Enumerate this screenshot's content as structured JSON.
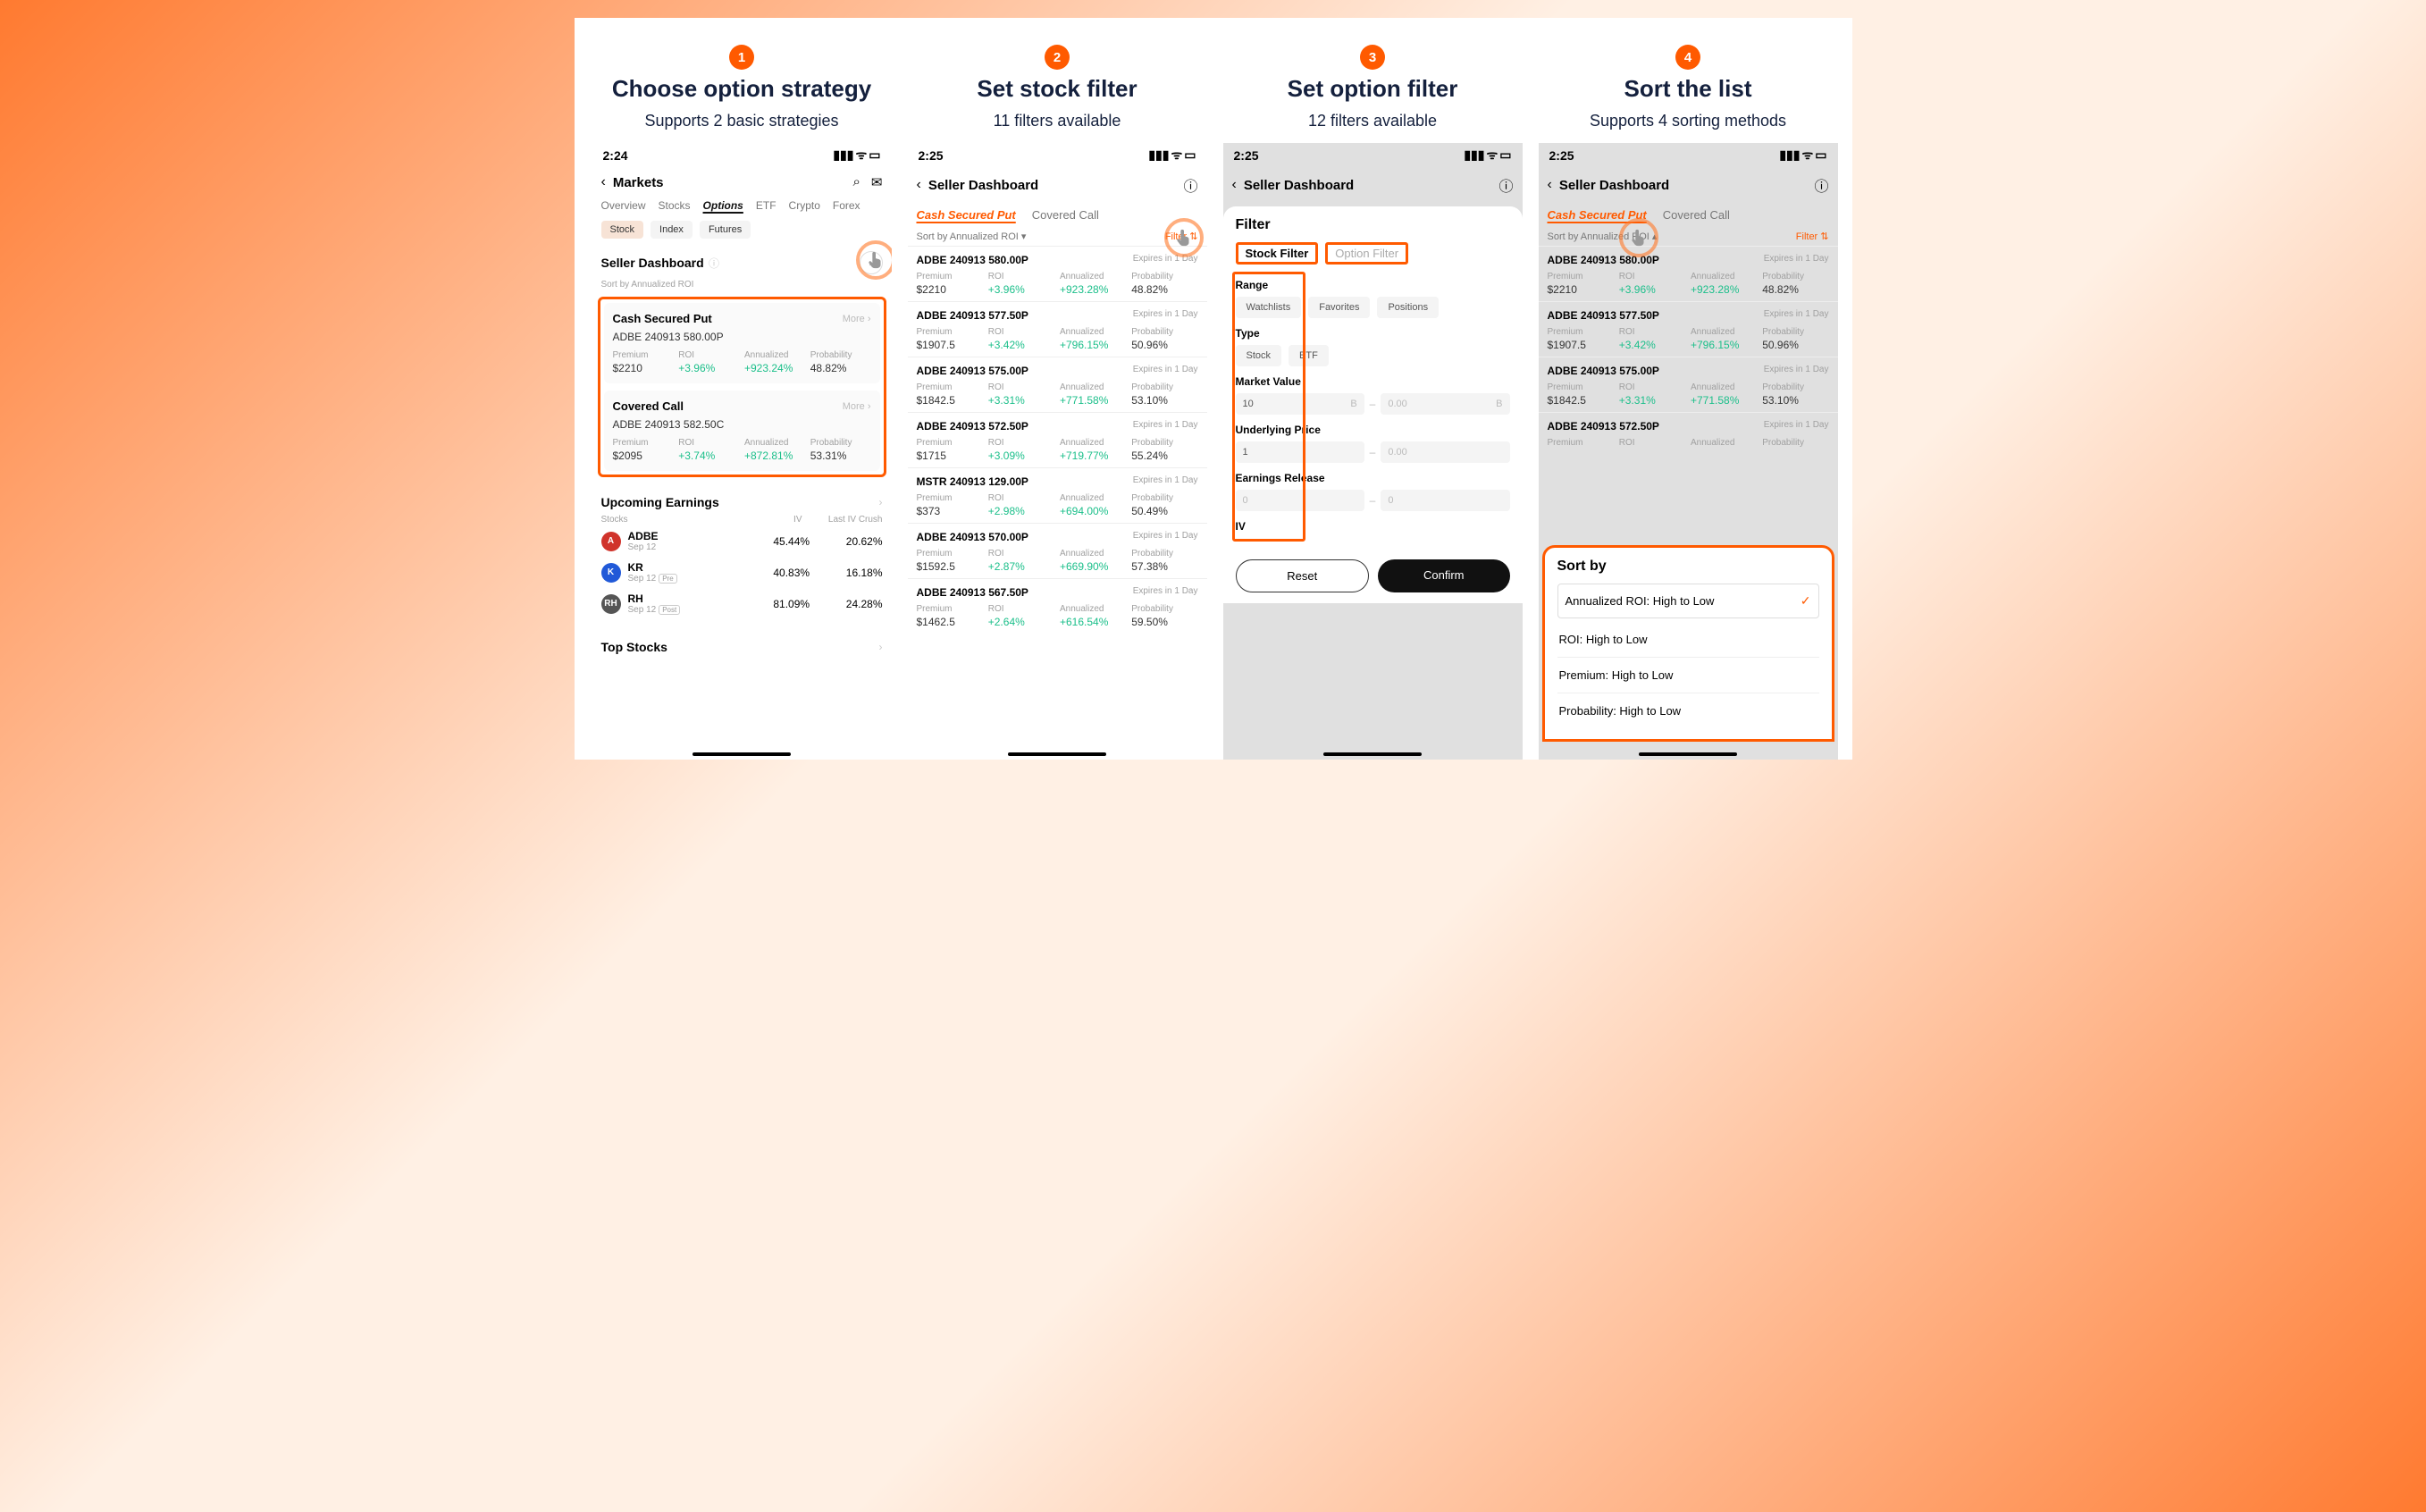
{
  "steps": [
    {
      "num": "1",
      "title": "Choose option strategy",
      "subtitle": "Supports 2 basic strategies"
    },
    {
      "num": "2",
      "title": "Set stock filter",
      "subtitle": "11 filters available"
    },
    {
      "num": "3",
      "title": "Set option filter",
      "subtitle": "12 filters available"
    },
    {
      "num": "4",
      "title": "Sort  the list",
      "subtitle": "Supports 4 sorting methods"
    }
  ],
  "screen1": {
    "time": "2:24",
    "header": "Markets",
    "tabs": [
      "Overview",
      "Stocks",
      "Options",
      "ETF",
      "Crypto",
      "Forex"
    ],
    "tabs_active": "Options",
    "chips": [
      "Stock",
      "Index",
      "Futures"
    ],
    "section": "Seller Dashboard",
    "sort": "Sort by Annualized ROI",
    "cards": [
      {
        "name": "Cash Secured Put",
        "more": "More  ›",
        "symbol": "ADBE 240913 580.00P",
        "premium": "$2210",
        "roi": "+3.96%",
        "ann": "+923.24%",
        "prob": "48.82%"
      },
      {
        "name": "Covered Call",
        "more": "More  ›",
        "symbol": "ADBE 240913 582.50C",
        "premium": "$2095",
        "roi": "+3.74%",
        "ann": "+872.81%",
        "prob": "53.31%"
      }
    ],
    "metric_labels": {
      "premium": "Premium",
      "roi": "ROI",
      "ann": "Annualized",
      "prob": "Probability"
    },
    "earnings": {
      "title": "Upcoming Earnings",
      "cols": {
        "stocks": "Stocks",
        "iv": "IV",
        "crush": "Last IV Crush"
      },
      "rows": [
        {
          "icon": "A",
          "bg": "#d0332b",
          "ticker": "ADBE",
          "date": "Sep 12",
          "tag": "",
          "iv": "45.44%",
          "crush": "20.62%"
        },
        {
          "icon": "K",
          "bg": "#2159d8",
          "ticker": "KR",
          "date": "Sep 12",
          "tag": "Pre",
          "iv": "40.83%",
          "crush": "16.18%"
        },
        {
          "icon": "RH",
          "bg": "#555",
          "ticker": "RH",
          "date": "Sep 12",
          "tag": "Post",
          "iv": "81.09%",
          "crush": "24.28%"
        }
      ]
    },
    "top": "Top Stocks"
  },
  "screen2": {
    "time": "2:25",
    "header": "Seller Dashboard",
    "strategy": {
      "a": "Cash Secured Put",
      "b": "Covered Call"
    },
    "sort": "Sort by Annualized ROI ▾",
    "filter": "Filter ⇅",
    "expires": "Expires in 1 Day",
    "labels": {
      "premium": "Premium",
      "roi": "ROI",
      "ann": "Annualized",
      "prob": "Probability"
    },
    "rows": [
      {
        "sym": "ADBE 240913 580.00P",
        "premium": "$2210",
        "roi": "+3.96%",
        "ann": "+923.28%",
        "prob": "48.82%"
      },
      {
        "sym": "ADBE 240913 577.50P",
        "premium": "$1907.5",
        "roi": "+3.42%",
        "ann": "+796.15%",
        "prob": "50.96%"
      },
      {
        "sym": "ADBE 240913 575.00P",
        "premium": "$1842.5",
        "roi": "+3.31%",
        "ann": "+771.58%",
        "prob": "53.10%"
      },
      {
        "sym": "ADBE 240913 572.50P",
        "premium": "$1715",
        "roi": "+3.09%",
        "ann": "+719.77%",
        "prob": "55.24%"
      },
      {
        "sym": "MSTR 240913 129.00P",
        "premium": "$373",
        "roi": "+2.98%",
        "ann": "+694.00%",
        "prob": "50.49%"
      },
      {
        "sym": "ADBE 240913 570.00P",
        "premium": "$1592.5",
        "roi": "+2.87%",
        "ann": "+669.90%",
        "prob": "57.38%"
      },
      {
        "sym": "ADBE 240913 567.50P",
        "premium": "$1462.5",
        "roi": "+2.64%",
        "ann": "+616.54%",
        "prob": "59.50%"
      }
    ]
  },
  "screen3": {
    "time": "2:25",
    "header": "Seller Dashboard",
    "panel_title": "Filter",
    "tabs": {
      "a": "Stock Filter",
      "b": "Option Filter"
    },
    "sections": {
      "range": "Range",
      "range_items": [
        "Watchlists",
        "Favorites",
        "Positions"
      ],
      "type": "Type",
      "type_items": [
        "Stock",
        "ETF"
      ],
      "mv": "Market Value",
      "mv_lo": "10",
      "mv_hi": "0.00",
      "mv_suffix": "B",
      "up": "Underlying Price",
      "up_lo": "1",
      "up_hi": "0.00",
      "er": "Earnings Release",
      "er_lo": "0",
      "er_hi": "0",
      "iv": "IV"
    },
    "reset": "Reset",
    "confirm": "Confirm"
  },
  "screen4": {
    "time": "2:25",
    "header": "Seller Dashboard",
    "strategy": {
      "a": "Cash Secured Put",
      "b": "Covered Call"
    },
    "sort": "Sort by Annualized ROI ▴",
    "filter": "Filter ⇅",
    "expires": "Expires in 1 Day",
    "labels": {
      "premium": "Premium",
      "roi": "ROI",
      "ann": "Annualized",
      "prob": "Probability"
    },
    "rows": [
      {
        "sym": "ADBE 240913 580.00P",
        "premium": "$2210",
        "roi": "+3.96%",
        "ann": "+923.28%",
        "prob": "48.82%"
      },
      {
        "sym": "ADBE 240913 577.50P",
        "premium": "$1907.5",
        "roi": "+3.42%",
        "ann": "+796.15%",
        "prob": "50.96%"
      },
      {
        "sym": "ADBE 240913 575.00P",
        "premium": "$1842.5",
        "roi": "+3.31%",
        "ann": "+771.58%",
        "prob": "53.10%"
      },
      {
        "sym": "ADBE 240913 572.50P",
        "premium": "",
        "roi": "",
        "ann": "",
        "prob": ""
      }
    ],
    "sort_title": "Sort by",
    "sort_items": [
      "Annualized ROI: High to Low",
      "ROI: High to Low",
      "Premium: High to Low",
      "Probability: High to Low"
    ],
    "sort_selected": 0
  },
  "glyphs": {
    "chev_left": "‹",
    "chev_right": "›",
    "search": "⌕",
    "mail": "✉",
    "info": "ⓘ",
    "check": "✓"
  }
}
